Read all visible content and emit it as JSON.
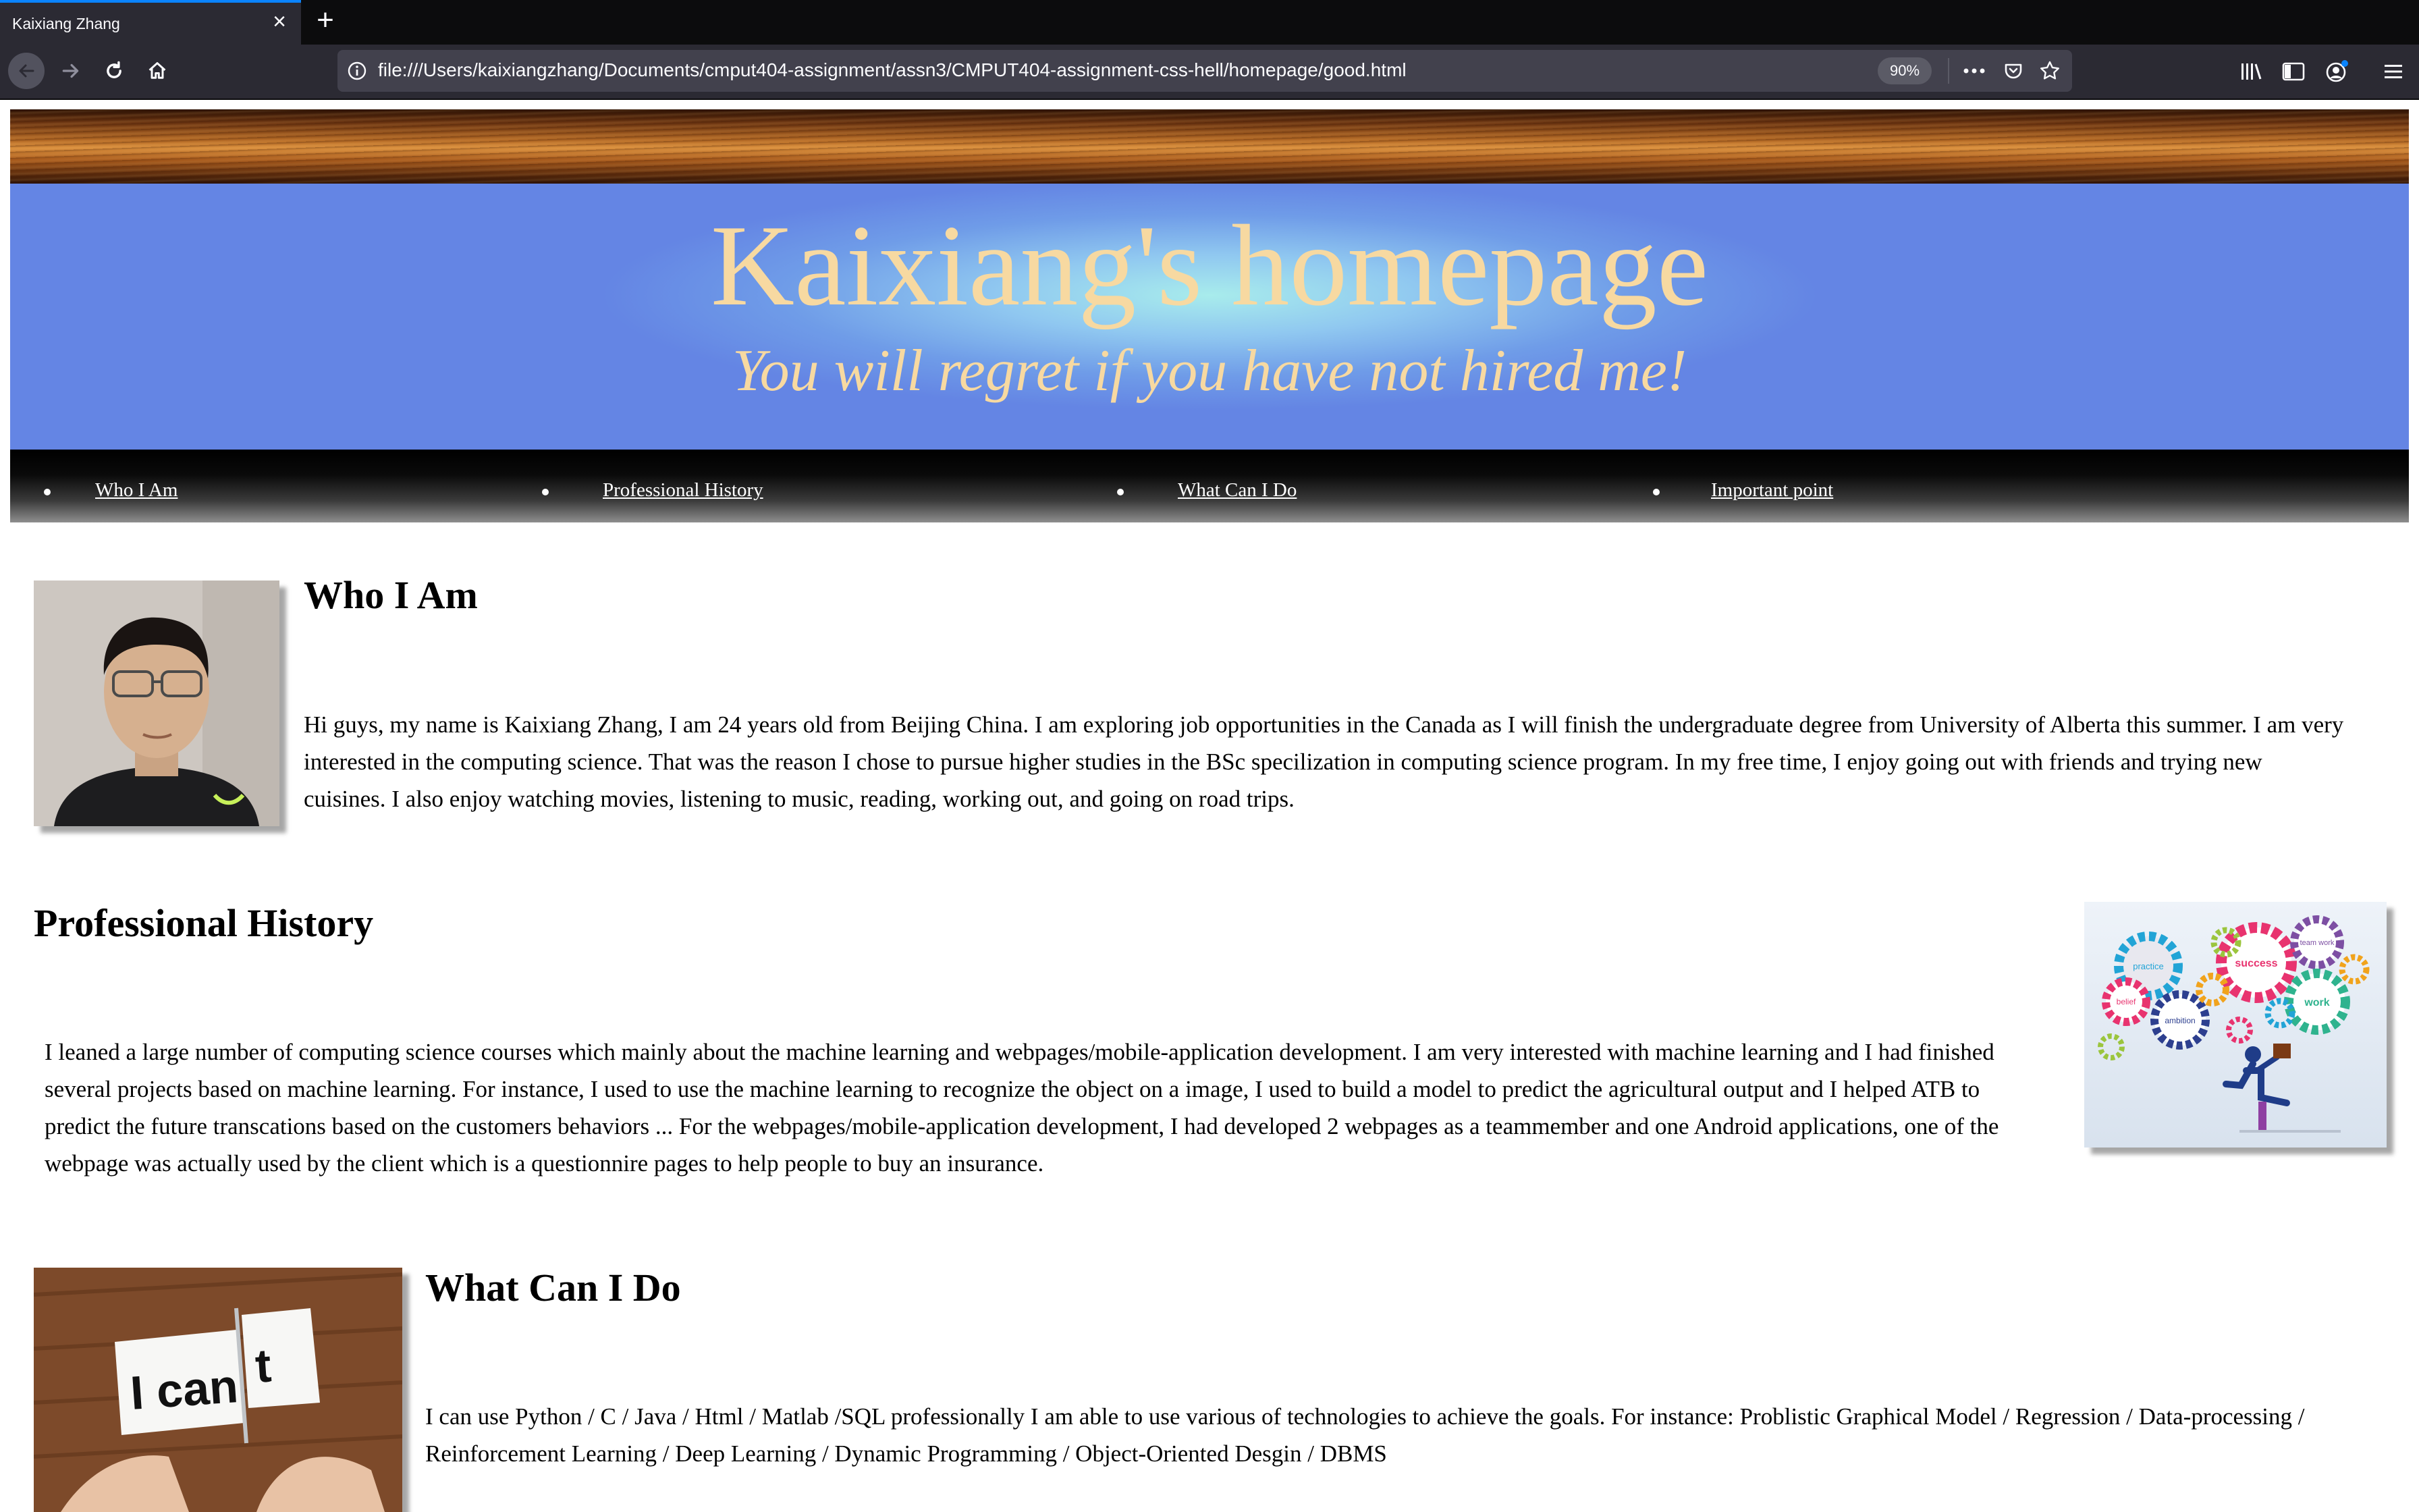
{
  "browser": {
    "tab_title": "Kaixiang Zhang",
    "close_glyph": "×",
    "new_tab_glyph": "+",
    "url": "file:///Users/kaixiangzhang/Documents/cmput404-assignment/assn3/CMPUT404-assignment-css-hell/homepage/good.html",
    "zoom": "90%",
    "accent_color": "#0a84ff",
    "icons": [
      "back-icon",
      "forward-icon",
      "reload-icon",
      "home-icon",
      "info-icon",
      "page-actions-icon",
      "pocket-icon",
      "bookmark-star-icon",
      "library-icon",
      "sidebar-icon",
      "account-icon",
      "hamburger-menu-icon"
    ]
  },
  "page": {
    "banner": {
      "title": "Kaixiang's homepage",
      "subtitle": "You will regret if you have not hired me!"
    },
    "nav": [
      {
        "label": "Who I Am"
      },
      {
        "label": "Professional History"
      },
      {
        "label": "What Can I Do"
      },
      {
        "label": "Important point"
      }
    ],
    "sections": {
      "who": {
        "heading": "Who I Am",
        "text": "Hi guys, my name is Kaixiang Zhang, I am 24 years old from Beijing China. I am exploring job opportunities in the Canada as I will finish the undergraduate degree from University of Alberta this summer. I am very interested in the computing science. That was the reason I chose to pursue higher studies in the BSc specilization in computing science program. In my free time, I enjoy going out with friends and trying new cuisines. I also enjoy watching movies, listening to music, reading, working out, and going on road trips."
      },
      "history": {
        "heading": "Professional History",
        "text": "I leaned a large number of computing science courses which mainly about the machine learning and webpages/mobile-application development. I am very interested with machine learning and I had finished several projects based on machine learning. For instance, I used to use the machine learning to recognize the object on a image, I used to build a model to predict the agricultural output and I helped ATB to predict the future transcations based on the customers behaviors ... For the webpages/mobile-application development, I had developed 2 webpages as a teammember and one Android applications, one of the webpage was actually used by the client which is a questionnire pages to help people to buy an insurance.",
        "image_words": [
          "practice",
          "success",
          "team work",
          "belief",
          "ambition",
          "work"
        ]
      },
      "what": {
        "heading": "What Can I Do",
        "text": "I can use Python / C / Java / Html / Matlab /SQL professionally I am able to use various of technologies to achieve the goals. For instance: Problistic Graphical Model / Regression / Data-processing / Reinforcement Learning / Deep Learning / Dynamic Programming / Object-Oriented Desgin / DBMS",
        "image_text_left": "I can",
        "image_text_right": "t"
      }
    }
  }
}
